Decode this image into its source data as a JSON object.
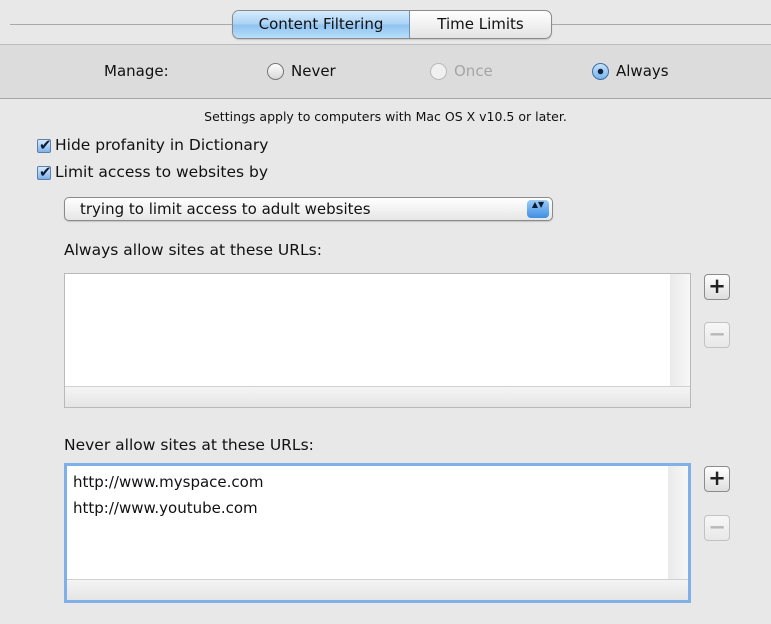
{
  "tabs": [
    {
      "label": "Content Filtering",
      "active": true
    },
    {
      "label": "Time Limits",
      "active": false
    }
  ],
  "manage": {
    "label": "Manage:",
    "options": [
      {
        "label": "Never",
        "selected": false,
        "enabled": true
      },
      {
        "label": "Once",
        "selected": false,
        "enabled": false
      },
      {
        "label": "Always",
        "selected": true,
        "enabled": true
      }
    ]
  },
  "note": "Settings apply to computers with Mac OS X v10.5 or later.",
  "hide_profanity": {
    "label": "Hide profanity in Dictionary",
    "checked": true
  },
  "limit_access": {
    "label": "Limit access to websites by",
    "checked": true
  },
  "limit_mode": {
    "selected": "trying to limit access to adult websites"
  },
  "always_allow": {
    "label": "Always allow sites at these URLs:",
    "items": []
  },
  "never_allow": {
    "label": "Never allow sites at these URLs:",
    "items": [
      "http://www.myspace.com",
      "http://www.youtube.com"
    ]
  },
  "icons": {
    "add": "+",
    "remove": "−",
    "check": "✔",
    "popup_arrows": "▲▼"
  },
  "colors": {
    "accent": "#8ec2f0",
    "focus_ring": "#7fb0e8",
    "background": "#e8e8e8"
  }
}
